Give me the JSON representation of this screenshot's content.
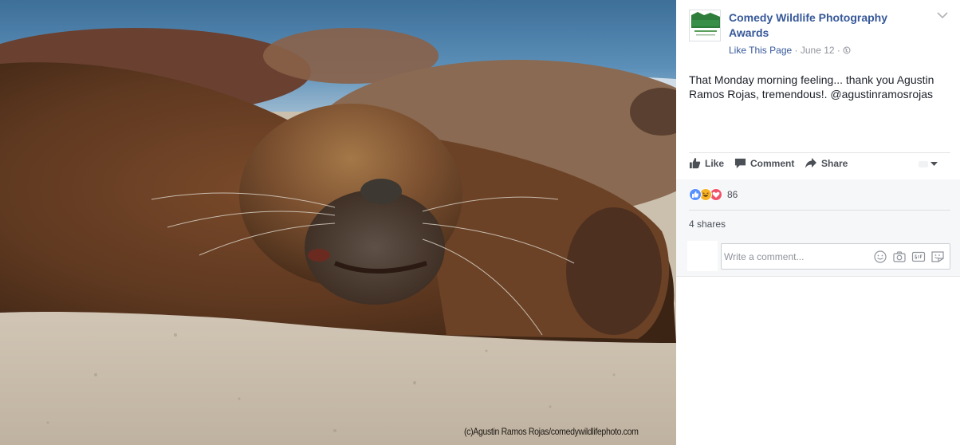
{
  "post": {
    "page_name": "Comedy Wildlife Photography Awards",
    "like_page": "Like This Page",
    "date": "June 12",
    "separator": "·",
    "text": "That Monday morning feeling... thank you Agustin Ramos Rojas, tremendous!. @agustinramosrojas"
  },
  "avatar": {
    "logo_text": "The Comedy Wildlife",
    "logo_sub": "comedywildlifephoto.com"
  },
  "photo": {
    "credit": "(c)Agustin Ramos Rojas/comedywildlifephoto.com"
  },
  "actions": {
    "like": "Like",
    "comment": "Comment",
    "share": "Share"
  },
  "stats": {
    "reaction_count": "86",
    "shares": "4 shares",
    "reactions": [
      "like-reaction-icon",
      "haha-reaction-icon",
      "love-reaction-icon"
    ]
  },
  "comment": {
    "placeholder": "Write a comment..."
  },
  "colors": {
    "link": "#365899",
    "like_blue": "#5890ff",
    "haha_yellow": "#f7b125",
    "love_red": "#f25268"
  }
}
